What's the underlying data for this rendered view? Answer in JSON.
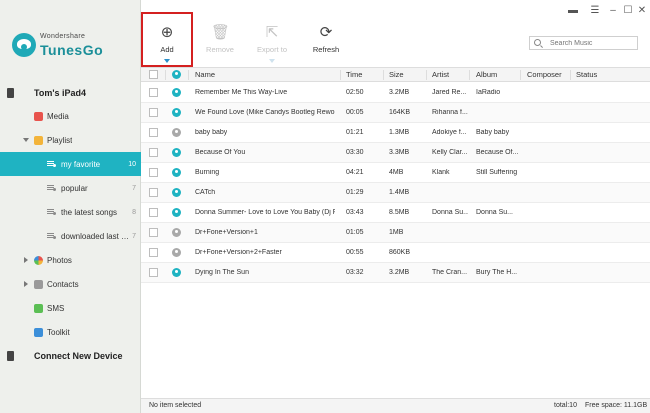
{
  "app": {
    "brand_small": "Wondershare",
    "brand_big": "TunesGo",
    "accent": "#1fb3c2"
  },
  "sidebar": {
    "device": "Tom's iPad4",
    "items": [
      {
        "label": "Media"
      },
      {
        "label": "Playlist"
      },
      {
        "label": "my favorite",
        "count": "10"
      },
      {
        "label": "popular",
        "count": "7"
      },
      {
        "label": "the latest songs",
        "count": "8"
      },
      {
        "label": "downloaded last w...",
        "count": "7"
      },
      {
        "label": "Photos"
      },
      {
        "label": "Contacts"
      },
      {
        "label": "SMS"
      },
      {
        "label": "Toolkit"
      }
    ],
    "connect": "Connect New Device"
  },
  "toolbar": {
    "add": "Add",
    "remove": "Remove",
    "export": "Export to",
    "refresh": "Refresh",
    "search_placeholder": "Search Music"
  },
  "table": {
    "headers": {
      "name": "Name",
      "time": "Time",
      "size": "Size",
      "artist": "Artist",
      "album": "Album",
      "composer": "Composer",
      "status": "Status"
    },
    "rows": [
      {
        "name": "Remember Me This Way-Live",
        "time": "02:50",
        "size": "3.2MB",
        "artist": "Jared Re...",
        "album": "IaRadio",
        "active": true
      },
      {
        "name": "We Found Love (Mike Candys Bootleg Rewor...",
        "time": "00:05",
        "size": "164KB",
        "artist": "Rihanna f...",
        "album": "",
        "active": true
      },
      {
        "name": "baby baby",
        "time": "01:21",
        "size": "1.3MB",
        "artist": "Adokiye f...",
        "album": "Baby baby",
        "active": false
      },
      {
        "name": "Because Of You",
        "time": "03:30",
        "size": "3.3MB",
        "artist": "Kelly Clar...",
        "album": "Because Of...",
        "active": true
      },
      {
        "name": "Burning",
        "time": "04:21",
        "size": "4MB",
        "artist": "Klank",
        "album": "Still Suffering",
        "active": true
      },
      {
        "name": "CATch",
        "time": "01:29",
        "size": "1.4MB",
        "artist": "",
        "album": "",
        "active": true
      },
      {
        "name": "Donna Summer- Love to Love You Baby (Dj Fli...",
        "time": "03:43",
        "size": "8.5MB",
        "artist": "Donna Su...",
        "album": "Donna Su...",
        "active": true
      },
      {
        "name": "Dr+Fone+Version+1",
        "time": "01:05",
        "size": "1MB",
        "artist": "",
        "album": "",
        "active": false
      },
      {
        "name": "Dr+Fone+Version+2+Faster",
        "time": "00:55",
        "size": "860KB",
        "artist": "",
        "album": "",
        "active": false
      },
      {
        "name": "Dying In The Sun",
        "time": "03:32",
        "size": "3.2MB",
        "artist": "The Cran...",
        "album": "Bury The H...",
        "active": true
      }
    ]
  },
  "statusbar": {
    "selection": "No item selected",
    "total": "total:10",
    "free": "Free space: 11.1GB"
  }
}
